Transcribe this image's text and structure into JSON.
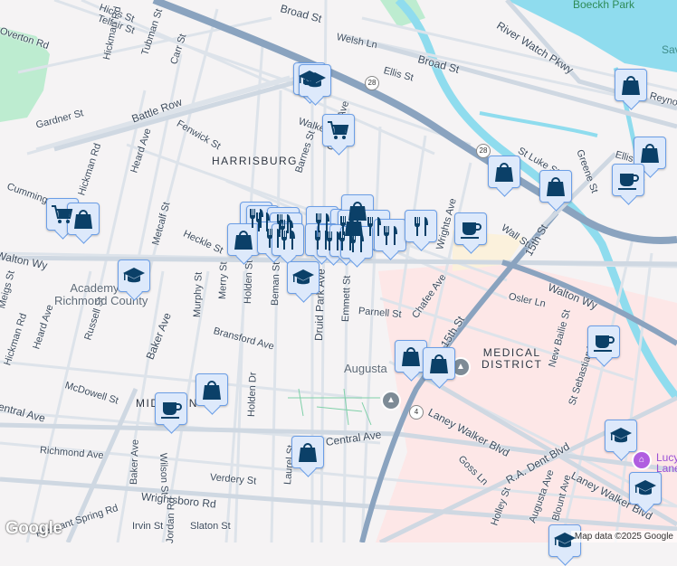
{
  "map": {
    "neighborhoods": [
      "HARRISBURG",
      "MEDICAL\nDISTRICT",
      "MIDTOWN"
    ],
    "parks": [
      "Boeckh Park"
    ],
    "water": [
      "Sav"
    ],
    "pois": [
      "Academy of\nRichmond County",
      "Augusta",
      "Lucy\nLane"
    ],
    "highway_shields": [
      "28",
      "28",
      "4"
    ],
    "streets": {
      "hicks": "Hicks St",
      "telfair": "Telfair St",
      "overton": "Overton Rd",
      "broad_top": "Broad St",
      "hickman1": "Hickman Rd",
      "tubman": "Tubman St",
      "carr": "Carr St",
      "battle": "Battle Row",
      "gardner": "Gardner St",
      "fenwick": "Fenwick St",
      "heard1": "Heard Ave",
      "hickman2": "Hickman Rd",
      "cumming": "Cumming St",
      "metcalf": "Metcalf St",
      "heckle": "Heckle St",
      "walton_w": "Walton Wy",
      "welsh": "Welsh Ln",
      "broad": "Broad St",
      "ellis": "Ellis St",
      "river_watch": "River Watch Pkwy",
      "greene": "Greene St",
      "st_luke": "St Luke St",
      "wall": "Wall St",
      "fifteenth": "15th St",
      "reynolds": "Reynolds St",
      "ellis2": "Ellis St",
      "walker": "Walker St",
      "barnes": "Barnes St",
      "chafee_n": "Chafee Ave",
      "wrightsboro_top": "Wrights Ave",
      "fenwick2": "Fenwick",
      "heard2": "Heard Ave",
      "russell": "Russell St",
      "baker1": "Baker Ave",
      "murphy": "Murphy St",
      "merry": "Merry St",
      "holden": "Holden St",
      "beman": "Beman St",
      "druid": "Druid Park Ave",
      "bransford": "Bransford Ave",
      "mcdowell": "McDowell St",
      "holden_dr": "Holden Dr",
      "richmond": "Richmond Ave",
      "baker2": "Baker Ave",
      "wilson": "Wilson St",
      "verdery": "Verdery St",
      "wrightsboro": "Wrightsboro Rd",
      "laurel": "Laurel St",
      "central": "Central Ave",
      "pleasant": "Pleasant Spring Rd",
      "irvin": "Irvin St",
      "jordan": "Jordan Rd",
      "slaton": "Slaton St",
      "meigs": "Meigs St",
      "hickman3": "Hickman Rd",
      "central_w": "Central Ave",
      "emmett": "Emmett St",
      "parnell": "Parnell St",
      "chafee": "Chafee Ave",
      "osler": "Osler Ln",
      "walton_e": "Walton Wy",
      "new_bailie": "New Bailie St",
      "st_sebastian": "St Sebastian Wy",
      "fifteenth2": "15th St",
      "laney1": "Laney Walker Blvd",
      "goss": "Goss Ln",
      "ra_dent": "R.A. Dent Blvd",
      "laney2": "Laney Walker Blvd",
      "holley": "Holley St",
      "augusta_ave": "Augusta Ave",
      "blount": "Blount Ave"
    },
    "attribution": "Map data ©2025 Google",
    "logo": "Google"
  },
  "colors": {
    "marker_fill": "#dde9fb",
    "marker_border": "#6b9ee6",
    "marker_glyph": "#0b4068",
    "highway": "#8aa3bf",
    "water": "#8fdcee",
    "medical": "#fde7e7",
    "park": "#bdecd0"
  }
}
